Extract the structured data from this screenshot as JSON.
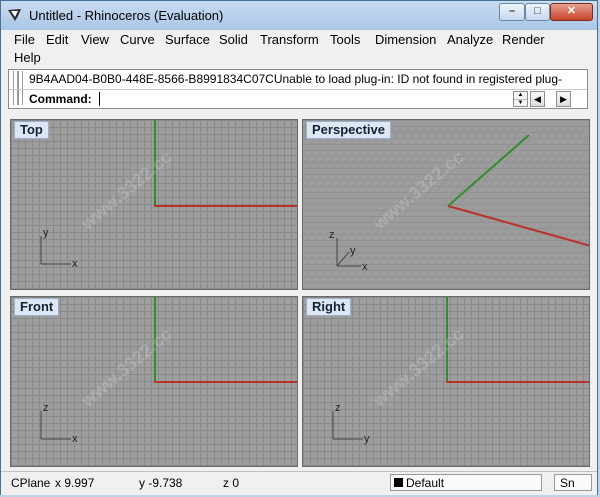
{
  "window": {
    "title": "Untitled - Rhinoceros (Evaluation)"
  },
  "titlebar_buttons": {
    "minimize": "–",
    "maximize": "□",
    "close": "✕"
  },
  "menu": [
    "File",
    "Edit",
    "View",
    "Curve",
    "Surface",
    "Solid",
    "Transform",
    "Tools",
    "Dimension",
    "Analyze",
    "Render",
    "Help"
  ],
  "command": {
    "history": "9B4AAD04-B0B0-448E-8566-B8991834C07CUnable to load plug-in: ID not found in registered plug-",
    "label": "Command:",
    "value": ""
  },
  "viewports": [
    {
      "label": "Top",
      "axes": [
        "y",
        "x"
      ]
    },
    {
      "label": "Perspective",
      "axes": [
        "z",
        "y",
        "x"
      ]
    },
    {
      "label": "Front",
      "axes": [
        "z",
        "x"
      ]
    },
    {
      "label": "Right",
      "axes": [
        "z",
        "y"
      ]
    }
  ],
  "status": {
    "cplane": "CPlane",
    "x": "x 9.997",
    "y": "y -9.738",
    "z": "z 0",
    "layer": "Default",
    "snap": "Sn"
  },
  "colors": {
    "x_axis": "#b8332c",
    "y_axis": "#2f8f2b",
    "viewport_bg": "#9e9e9e"
  },
  "watermark": "www.3322.cc"
}
